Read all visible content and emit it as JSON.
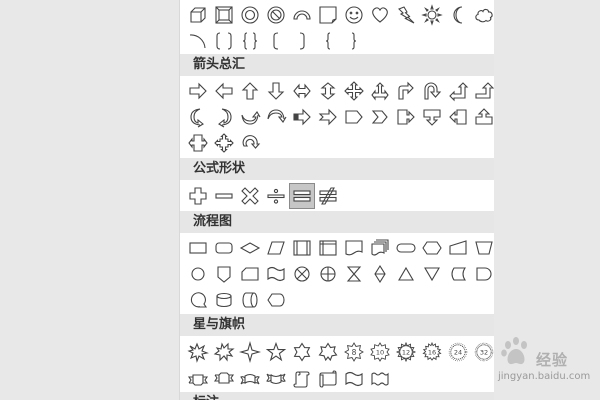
{
  "sections": {
    "arrows": "箭头总汇",
    "formula": "公式形状",
    "flowchart": "流程图",
    "stars": "星与旗帜",
    "callouts": "标注"
  },
  "shapes": {
    "basic_row_1": [
      "cube",
      "bevel",
      "donut",
      "no-symbol",
      "block-arc",
      "folded-corner",
      "smiley-face",
      "heart",
      "lightning-bolt",
      "sun",
      "moon",
      "cloud"
    ],
    "basic_row_2": [
      "arc",
      "double-bracket",
      "double-brace",
      "left-bracket",
      "right-bracket",
      "left-brace",
      "right-brace"
    ],
    "arrows_row_1": [
      "right-arrow",
      "left-arrow",
      "up-arrow",
      "down-arrow",
      "left-right-arrow",
      "up-down-arrow",
      "quad-arrow",
      "left-right-up-arrow",
      "bent-arrow",
      "u-turn-arrow",
      "left-up-arrow",
      "bent-up-arrow"
    ],
    "arrows_row_2": [
      "curved-right-arrow",
      "curved-left-arrow",
      "curved-up-arrow",
      "curved-down-arrow",
      "striped-right-arrow",
      "notched-right-arrow",
      "pentagon-arrow",
      "chevron",
      "right-arrow-callout",
      "down-arrow-callout",
      "left-arrow-callout",
      "up-arrow-callout"
    ],
    "arrows_row_3": [
      "left-right-arrow-callout",
      "quad-arrow-callout",
      "circular-arrow"
    ],
    "formula_row": [
      "plus",
      "minus",
      "multiply",
      "divide",
      "equal",
      "not-equal"
    ],
    "flow_row_1": [
      "process",
      "alternate-process",
      "decision",
      "data",
      "predefined-process",
      "internal-storage",
      "document",
      "multidocument",
      "terminator",
      "preparation",
      "manual-input",
      "manual-operation"
    ],
    "flow_row_2": [
      "connector",
      "off-page-connector",
      "card",
      "punched-tape",
      "summing-junction",
      "or",
      "collate",
      "sort",
      "extract",
      "merge",
      "stored-data",
      "delay"
    ],
    "flow_row_3": [
      "sequential-access-storage",
      "magnetic-disk",
      "direct-access-storage",
      "display"
    ],
    "stars_row_1": [
      "explosion-1",
      "explosion-2",
      "4-point-star",
      "5-point-star",
      "6-point-star",
      "7-point-star",
      "8-point-star",
      "10-point-star",
      "12-point-star",
      "16-point-star",
      "24-point-star",
      "32-point-star"
    ],
    "stars_row_2": [
      "up-ribbon",
      "down-ribbon",
      "curved-up-ribbon",
      "curved-down-ribbon",
      "vertical-scroll",
      "horizontal-scroll",
      "wave",
      "double-wave"
    ]
  },
  "star_labels": [
    "8",
    "10",
    "12",
    "16",
    "24",
    "32"
  ],
  "selected_shape": "equal",
  "watermark": {
    "text_cn": "经验",
    "url": "jingyan.baidu.com"
  }
}
